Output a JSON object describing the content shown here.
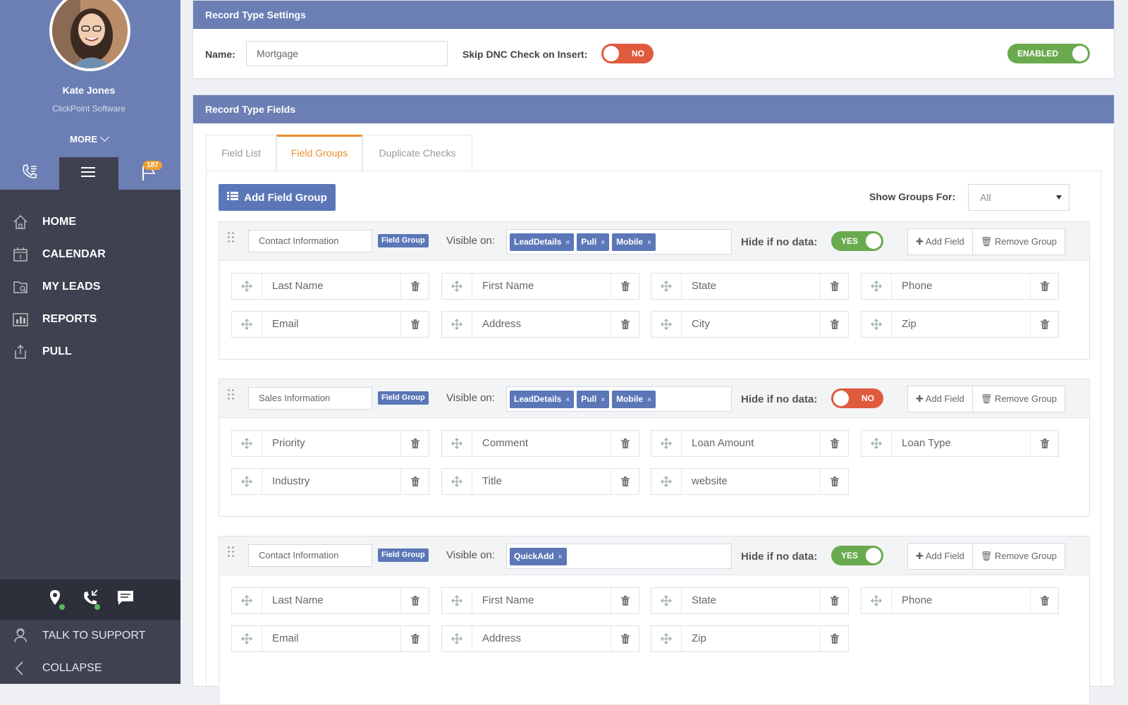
{
  "user": {
    "name": "Kate Jones",
    "company": "ClickPoint Software",
    "more_label": "MORE"
  },
  "icon_bar": {
    "flag_badge": "187"
  },
  "nav": [
    {
      "label": "HOME",
      "icon": "home-icon"
    },
    {
      "label": "CALENDAR",
      "icon": "calendar-icon"
    },
    {
      "label": "MY LEADS",
      "icon": "leads-icon"
    },
    {
      "label": "REPORTS",
      "icon": "reports-icon"
    },
    {
      "label": "PULL",
      "icon": "pull-icon"
    }
  ],
  "bottom_nav": {
    "support": "TALK TO SUPPORT",
    "collapse": "COLLAPSE"
  },
  "settings": {
    "header": "Record Type Settings",
    "name_label": "Name:",
    "name_value": "Mortgage",
    "skip_dnc_label": "Skip DNC Check on Insert:",
    "skip_dnc_toggle": "NO",
    "enabled_toggle": "ENABLED"
  },
  "fields_panel": {
    "header": "Record Type Fields",
    "tabs": [
      "Field List",
      "Field Groups",
      "Duplicate Checks"
    ],
    "active_tab": "Field Groups",
    "add_group_label": "Add Field Group",
    "show_groups_label": "Show Groups For:",
    "show_groups_value": "All"
  },
  "group_labels": {
    "badge": "Field Group",
    "visible_on": "Visible on:",
    "hide_if_no_data": "Hide if no data:",
    "add_field": "Add Field",
    "remove_group": "Remove Group",
    "tag_remove": "×"
  },
  "groups": [
    {
      "name": "Contact Information",
      "visible_on": [
        "LeadDetails",
        "Pull",
        "Mobile"
      ],
      "hide_if_no_data": "YES",
      "fields": [
        "Last Name",
        "First Name",
        "State",
        "Phone",
        "Email",
        "Address",
        "City",
        "Zip"
      ]
    },
    {
      "name": "Sales Information",
      "visible_on": [
        "LeadDetails",
        "Pull",
        "Mobile"
      ],
      "hide_if_no_data": "NO",
      "fields": [
        "Priority",
        "Comment",
        "Loan Amount",
        "Loan Type",
        "Industry",
        "Title",
        "website"
      ]
    },
    {
      "name": "Contact Information",
      "visible_on": [
        "QuickAdd"
      ],
      "hide_if_no_data": "YES",
      "fields": [
        "Last Name",
        "First Name",
        "State",
        "Phone",
        "Email",
        "Address",
        "Zip"
      ]
    }
  ]
}
